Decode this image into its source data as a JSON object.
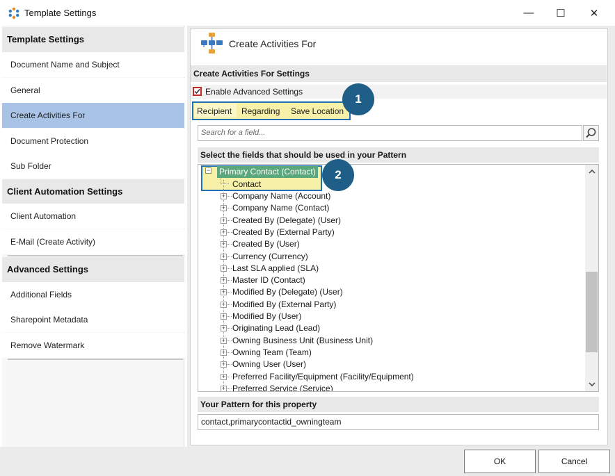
{
  "window": {
    "title": "Template Settings",
    "minimize": "—",
    "maximize": "☐",
    "close": "✕"
  },
  "sidebar": {
    "sections": [
      {
        "title": "Template Settings",
        "items": [
          "Document Name and Subject",
          "General",
          "Create Activities For",
          "Document Protection",
          "Sub Folder"
        ]
      },
      {
        "title": "Client Automation Settings",
        "items": [
          "Client Automation",
          "E-Mail (Create Activity)"
        ]
      },
      {
        "title": "Advanced Settings",
        "items": [
          "Additional Fields",
          "Sharepoint Metadata",
          "Remove Watermark"
        ]
      }
    ],
    "selected": "Create Activities For"
  },
  "main": {
    "header_title": "Create Activities For",
    "settings_section": "Create Activities For Settings",
    "enable_advanced": {
      "label": "Enable Advanced Settings",
      "checked": true
    },
    "tabs": [
      "Recipient",
      "Regarding",
      "Save Location"
    ],
    "active_tab": "Recipient",
    "search": {
      "placeholder": "Search for a field..."
    },
    "fields_section": "Select the fields that should be used in your Pattern",
    "tree": {
      "root": "Primary Contact (Contact)",
      "selected_child": "Contact",
      "children": [
        "Company Name (Account)",
        "Company Name (Contact)",
        "Created By (Delegate) (User)",
        "Created By (External Party)",
        "Created By (User)",
        "Currency (Currency)",
        "Last SLA applied (SLA)",
        "Master ID (Contact)",
        "Modified By (Delegate) (User)",
        "Modified By (External Party)",
        "Modified By (User)",
        "Originating Lead (Lead)",
        "Owning Business Unit (Business Unit)",
        "Owning Team (Team)",
        "Owning User (User)",
        "Preferred Facility/Equipment (Facility/Equipment)",
        "Preferred Service (Service)"
      ]
    },
    "pattern_section": "Your Pattern for this property",
    "pattern_value": "contact,primarycontactid_owningteam"
  },
  "callouts": [
    "1",
    "2"
  ],
  "footer": {
    "ok": "OK",
    "cancel": "Cancel"
  },
  "colors": {
    "selection": "#a9c3e6",
    "tab_bg": "#f6f0a8",
    "highlight_border": "#1f6fb3",
    "callout": "#1f5e86",
    "tree_selected": "#5aa77c",
    "checkbox": "#c62828"
  }
}
